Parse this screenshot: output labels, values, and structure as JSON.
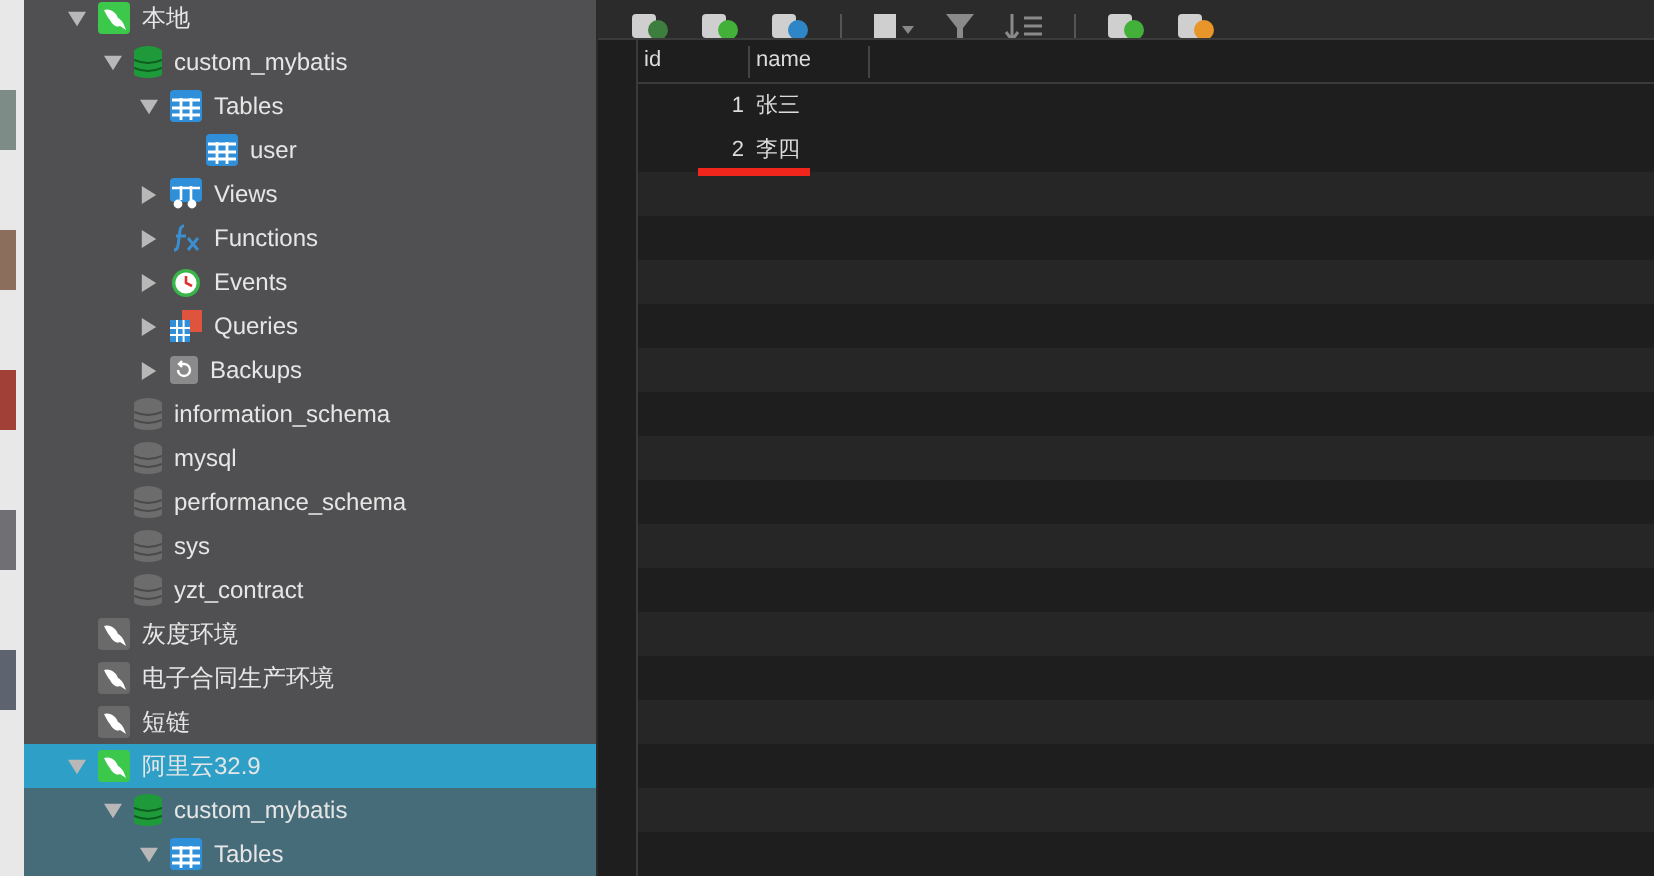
{
  "tree": [
    {
      "kind": "connection",
      "label": "本地",
      "connected": true,
      "selected": false,
      "expanded": true,
      "children": [
        {
          "kind": "database",
          "label": "custom_mybatis",
          "open": true,
          "selected": false,
          "expanded": true,
          "children": [
            {
              "kind": "tables",
              "label": "Tables",
              "selected": false,
              "expanded": true,
              "children": [
                {
                  "kind": "table",
                  "label": "user",
                  "selected": false
                }
              ]
            },
            {
              "kind": "views",
              "label": "Views",
              "selected": false,
              "expanded": false
            },
            {
              "kind": "functions",
              "label": "Functions",
              "selected": false,
              "expanded": false
            },
            {
              "kind": "events",
              "label": "Events",
              "selected": false,
              "expanded": false
            },
            {
              "kind": "queries",
              "label": "Queries",
              "selected": false,
              "expanded": false
            },
            {
              "kind": "backups",
              "label": "Backups",
              "selected": false,
              "expanded": false
            }
          ]
        },
        {
          "kind": "database",
          "label": "information_schema",
          "open": false,
          "selected": false
        },
        {
          "kind": "database",
          "label": "mysql",
          "open": false,
          "selected": false
        },
        {
          "kind": "database",
          "label": "performance_schema",
          "open": false,
          "selected": false
        },
        {
          "kind": "database",
          "label": "sys",
          "open": false,
          "selected": false
        },
        {
          "kind": "database",
          "label": "yzt_contract",
          "open": false,
          "selected": false
        }
      ]
    },
    {
      "kind": "connection",
      "label": "灰度环境",
      "connected": false,
      "selected": false
    },
    {
      "kind": "connection",
      "label": "电子合同生产环境",
      "connected": false,
      "selected": false
    },
    {
      "kind": "connection",
      "label": "短链",
      "connected": false,
      "selected": false
    },
    {
      "kind": "connection",
      "label": "阿里云32.9",
      "connected": true,
      "selected": true,
      "expanded": true,
      "children": [
        {
          "kind": "database",
          "label": "custom_mybatis",
          "open": true,
          "selected": false,
          "expanded": true,
          "children": [
            {
              "kind": "tables",
              "label": "Tables",
              "selected": false,
              "expanded": true
            }
          ]
        }
      ]
    }
  ],
  "table": {
    "columns": [
      "id",
      "name"
    ],
    "rows": [
      {
        "cells": [
          "1",
          "张三"
        ],
        "underlined": false
      },
      {
        "cells": [
          "2",
          "李四"
        ],
        "underlined": true
      }
    ]
  }
}
